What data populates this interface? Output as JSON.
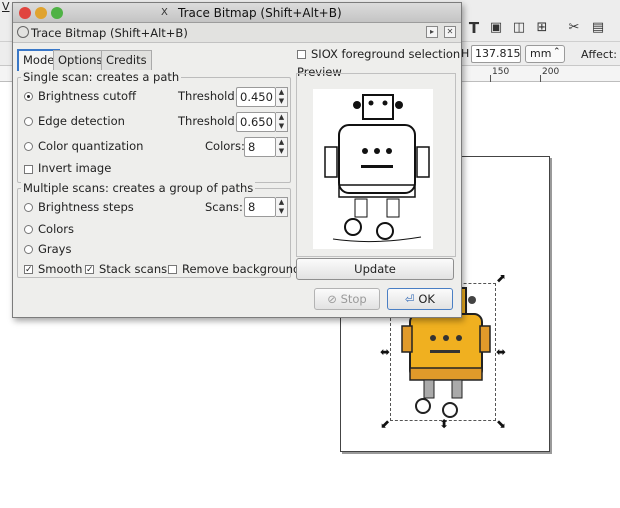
{
  "background": {
    "menu_fragment": "V",
    "height_label": "H",
    "height_value": "137.815",
    "unit": "mm",
    "affect_label": "Affect:",
    "ruler_labels": [
      "150",
      "200"
    ]
  },
  "dialog": {
    "window_title": "Trace Bitmap (Shift+Alt+B)",
    "panel_title": "Trace Bitmap (Shift+Alt+B)",
    "tabs": [
      "Mode",
      "Options",
      "Credits"
    ],
    "single_scan": {
      "title": "Single scan: creates a path",
      "brightness_label": "Brightness cutoff",
      "brightness_threshold_label": "Threshold:",
      "brightness_threshold": "0.450",
      "edge_label": "Edge detection",
      "edge_threshold_label": "Threshold:",
      "edge_threshold": "0.650",
      "color_quant_label": "Color quantization",
      "colors_label": "Colors:",
      "colors_value": "8",
      "invert_label": "Invert image"
    },
    "multi_scan": {
      "title": "Multiple scans: creates a group of paths",
      "brightness_steps_label": "Brightness steps",
      "scans_label": "Scans:",
      "scans_value": "8",
      "colors_label": "Colors",
      "grays_label": "Grays",
      "smooth_label": "Smooth",
      "stack_label": "Stack scans",
      "remove_bg_label": "Remove background"
    },
    "siox_label": "SIOX foreground selection",
    "preview_label": "Preview",
    "update_label": "Update",
    "stop_label": "Stop",
    "ok_label": "OK"
  }
}
